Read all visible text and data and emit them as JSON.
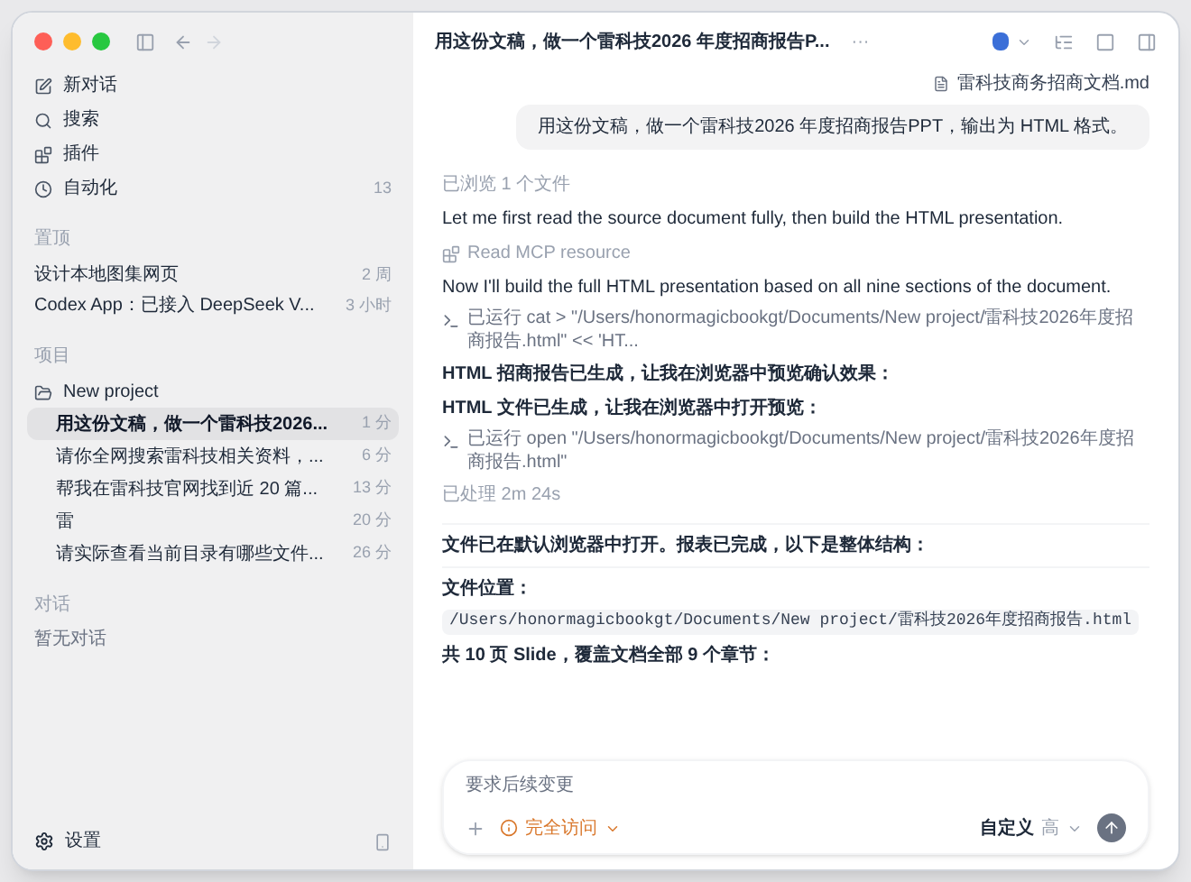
{
  "window": {
    "title": "用这份文稿，做一个雷科技2026 年度招商报告P...",
    "title_more": "···"
  },
  "sidebar": {
    "nav": [
      {
        "label": "新对话"
      },
      {
        "label": "搜索"
      },
      {
        "label": "插件"
      },
      {
        "label": "自动化",
        "badge": "13"
      }
    ],
    "pinned": {
      "heading": "置顶",
      "items": [
        {
          "label": "设计本地图集网页",
          "time": "2 周"
        },
        {
          "label": "Codex App：已接入 DeepSeek V...",
          "time": "3 小时"
        }
      ]
    },
    "projects": {
      "heading": "项目",
      "project": "New project",
      "items": [
        {
          "label": "用这份文稿，做一个雷科技2026...",
          "time": "1 分",
          "selected": true
        },
        {
          "label": "请你全网搜索雷科技相关资料，...",
          "time": "6 分",
          "selected": false
        },
        {
          "label": "帮我在雷科技官网找到近 20 篇...",
          "time": "13 分",
          "selected": false
        },
        {
          "label": "雷",
          "time": "20 分",
          "selected": false
        },
        {
          "label": "请实际查看当前目录有哪些文件...",
          "time": "26 分",
          "selected": false
        }
      ]
    },
    "chats": {
      "heading": "对话",
      "empty": "暂无对话"
    },
    "settings": "设置"
  },
  "attachment": "雷科技商务招商文档.md",
  "user_message": "用这份文稿，做一个雷科技2026 年度招商报告PPT，输出为 HTML 格式。",
  "messages": [
    {
      "kind": "meta",
      "text": "已浏览 1 个文件"
    },
    {
      "kind": "text",
      "text": "Let me first read the source document fully, then build the HTML presentation."
    },
    {
      "kind": "tool",
      "text": "Read MCP resource"
    },
    {
      "kind": "text",
      "text": "Now I'll build the full HTML presentation based on all nine sections of the document."
    },
    {
      "kind": "command",
      "text": "已运行 cat > \"/Users/honormagicbookgt/Documents/New project/雷科技2026年度招商报告.html\" << 'HT..."
    },
    {
      "kind": "bold",
      "text": "HTML 招商报告已生成，让我在浏览器中预览确认效果："
    },
    {
      "kind": "bold",
      "text": "HTML 文件已生成，让我在浏览器中打开预览："
    },
    {
      "kind": "command",
      "text": "已运行 open \"/Users/honormagicbookgt/Documents/New project/雷科技2026年度招商报告.html\""
    },
    {
      "kind": "summary",
      "text": "已处理 2m 24s"
    },
    {
      "kind": "bold",
      "text": "文件已在默认浏览器中打开。报表已完成，以下是整体结构："
    },
    {
      "kind": "rule"
    },
    {
      "kind": "path",
      "label": "文件位置：",
      "code": "/Users/honormagicbookgt/Documents/New project/雷科技2026年度招商报告.html"
    },
    {
      "kind": "bold",
      "text": "共 10 页 Slide，覆盖文档全部 9 个章节："
    }
  ],
  "composer": {
    "placeholder": "要求后续变更",
    "access": "完全访问",
    "model": "自定义",
    "effort": "高"
  }
}
